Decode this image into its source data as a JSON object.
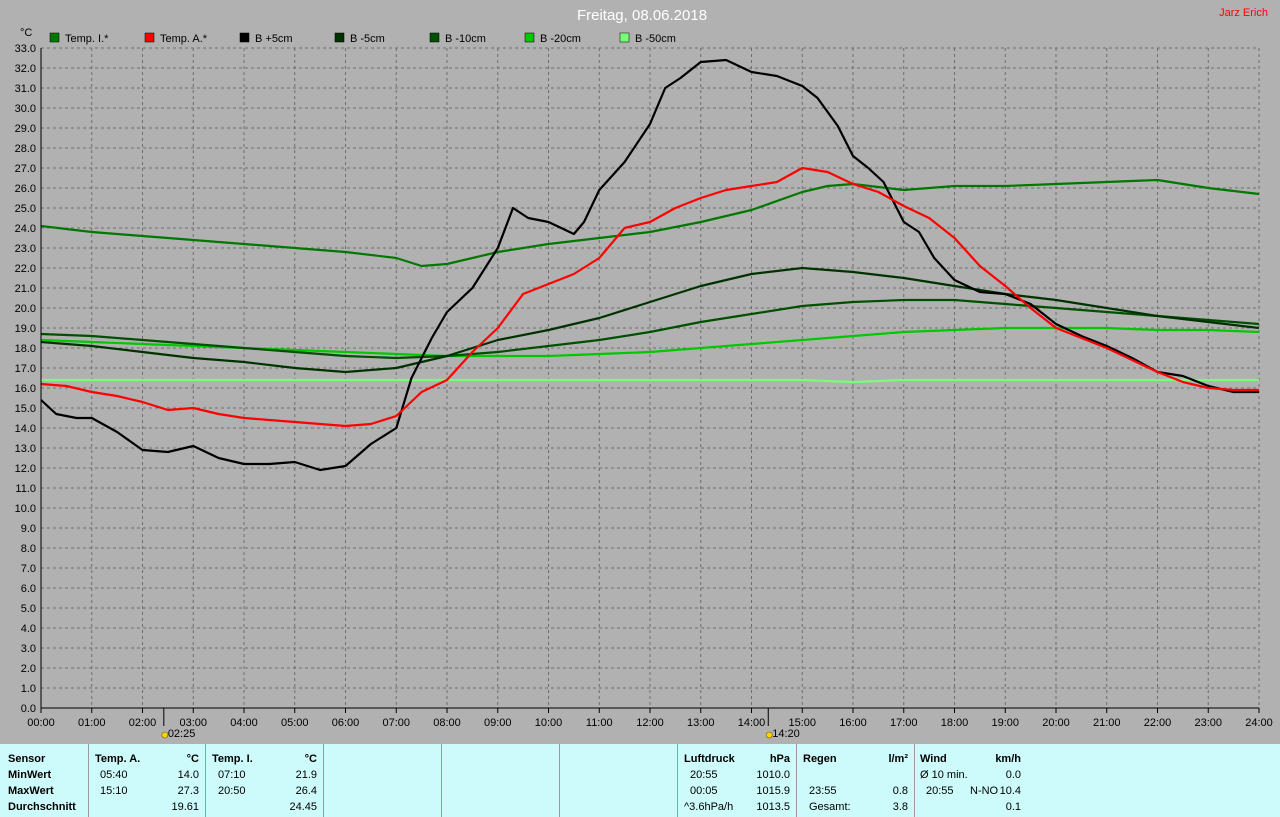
{
  "header": {
    "title": "Freitag, 08.06.2018",
    "author": "Jarz Erich",
    "y_unit": "°C"
  },
  "colors": {
    "background": "#b1b1b1",
    "plot_background": "#b1b1b1",
    "info_background": "#cdfafa",
    "title_color": "#ffffff",
    "author_color": "#ff0000"
  },
  "chart_data": {
    "type": "line",
    "title": "Freitag, 08.06.2018",
    "ylabel": "°C",
    "xlabel": "",
    "ylim": [
      0,
      33
    ],
    "xlim": [
      0,
      24
    ],
    "yticks": [
      "0.0",
      "1.0",
      "2.0",
      "3.0",
      "4.0",
      "5.0",
      "6.0",
      "7.0",
      "8.0",
      "9.0",
      "10.0",
      "11.0",
      "12.0",
      "13.0",
      "14.0",
      "15.0",
      "16.0",
      "17.0",
      "18.0",
      "19.0",
      "20.0",
      "21.0",
      "22.0",
      "23.0",
      "24.0",
      "25.0",
      "26.0",
      "27.0",
      "28.0",
      "29.0",
      "30.0",
      "31.0",
      "32.0",
      "33.0"
    ],
    "xticks": [
      "00:00",
      "01:00",
      "02:00",
      "03:00",
      "04:00",
      "05:00",
      "06:00",
      "07:00",
      "08:00",
      "09:00",
      "10:00",
      "11:00",
      "12:00",
      "13:00",
      "14:00",
      "15:00",
      "16:00",
      "17:00",
      "18:00",
      "19:00",
      "20:00",
      "21:00",
      "22:00",
      "23:00",
      "24:00"
    ],
    "grid": true,
    "legend_position": "top",
    "markers": [
      {
        "label": "02:25",
        "x": 2.42,
        "icon": "sunrise-icon"
      },
      {
        "label": "14:20",
        "x": 14.33,
        "icon": "sun-icon"
      }
    ],
    "series": [
      {
        "name": "Temp. I.*",
        "color": "#007800",
        "x": [
          0,
          1,
          2,
          3,
          4,
          5,
          6,
          7,
          7.5,
          8,
          9,
          10,
          11,
          12,
          13,
          14,
          15,
          15.5,
          16,
          17,
          18,
          19,
          20,
          21,
          22,
          23,
          24
        ],
        "y": [
          24.1,
          23.8,
          23.6,
          23.4,
          23.2,
          23.0,
          22.8,
          22.5,
          22.1,
          22.2,
          22.8,
          23.2,
          23.5,
          23.8,
          24.3,
          24.9,
          25.8,
          26.1,
          26.2,
          25.9,
          26.1,
          26.1,
          26.2,
          26.3,
          26.4,
          26.0,
          25.7
        ]
      },
      {
        "name": "Temp. A.*",
        "color": "#ff0000",
        "x": [
          0,
          0.5,
          1,
          1.5,
          2,
          2.5,
          3,
          3.5,
          4,
          4.5,
          5,
          5.5,
          6,
          6.5,
          7,
          7.5,
          8,
          8.5,
          9,
          9.5,
          10,
          10.5,
          11,
          11.5,
          12,
          12.5,
          13,
          13.5,
          14,
          14.5,
          15,
          15.5,
          16,
          16.5,
          17,
          17.5,
          18,
          18.5,
          19,
          19.5,
          20,
          20.5,
          21,
          21.5,
          22,
          22.5,
          23,
          23.5,
          24
        ],
        "y": [
          16.2,
          16.1,
          15.8,
          15.6,
          15.3,
          14.9,
          15.0,
          14.7,
          14.5,
          14.4,
          14.3,
          14.2,
          14.1,
          14.2,
          14.6,
          15.8,
          16.4,
          17.8,
          19.0,
          20.7,
          21.2,
          21.7,
          22.5,
          24.0,
          24.3,
          25.0,
          25.5,
          25.9,
          26.1,
          26.3,
          27.0,
          26.8,
          26.2,
          25.8,
          25.1,
          24.5,
          23.5,
          22.1,
          21.1,
          20.0,
          19.0,
          18.5,
          18.0,
          17.4,
          16.8,
          16.3,
          16.0,
          15.9,
          15.9
        ]
      },
      {
        "name": "B +5cm",
        "color": "#000000",
        "x": [
          0,
          0.3,
          0.7,
          1,
          1.5,
          2,
          2.5,
          3,
          3.5,
          4,
          4.5,
          5,
          5.5,
          6,
          6.5,
          7,
          7.3,
          7.7,
          8,
          8.5,
          9,
          9.3,
          9.6,
          10,
          10.5,
          10.7,
          11,
          11.5,
          12,
          12.3,
          12.6,
          13,
          13.5,
          14,
          14.5,
          15,
          15.3,
          15.7,
          16,
          16.3,
          16.6,
          17,
          17.3,
          17.6,
          18,
          18.5,
          19,
          19.5,
          20,
          20.5,
          21,
          21.5,
          22,
          22.5,
          23,
          23.5,
          24
        ],
        "y": [
          15.4,
          14.7,
          14.5,
          14.5,
          13.8,
          12.9,
          12.8,
          13.1,
          12.5,
          12.2,
          12.2,
          12.3,
          11.9,
          12.1,
          13.2,
          14.0,
          16.5,
          18.5,
          19.8,
          21.0,
          23.0,
          25.0,
          24.5,
          24.3,
          23.7,
          24.3,
          25.9,
          27.3,
          29.2,
          31.0,
          31.5,
          32.3,
          32.4,
          31.8,
          31.6,
          31.1,
          30.5,
          29.1,
          27.6,
          27.0,
          26.3,
          24.3,
          23.8,
          22.5,
          21.4,
          20.8,
          20.7,
          20.2,
          19.2,
          18.6,
          18.1,
          17.5,
          16.8,
          16.6,
          16.1,
          15.8,
          15.8
        ]
      },
      {
        "name": "B -5cm",
        "color": "#003200",
        "x": [
          0,
          1,
          2,
          3,
          4,
          5,
          6,
          7,
          8,
          9,
          10,
          11,
          12,
          13,
          14,
          15,
          16,
          17,
          18,
          19,
          20,
          21,
          22,
          23,
          24
        ],
        "y": [
          18.3,
          18.1,
          17.8,
          17.5,
          17.3,
          17.0,
          16.8,
          17.0,
          17.6,
          18.4,
          18.9,
          19.5,
          20.3,
          21.1,
          21.7,
          22.0,
          21.8,
          21.5,
          21.1,
          20.7,
          20.4,
          20.0,
          19.6,
          19.3,
          19.0
        ]
      },
      {
        "name": "B -10cm",
        "color": "#005000",
        "x": [
          0,
          1,
          2,
          3,
          4,
          5,
          6,
          7,
          8,
          9,
          10,
          11,
          12,
          13,
          14,
          15,
          16,
          17,
          18,
          19,
          20,
          21,
          22,
          23,
          24
        ],
        "y": [
          18.7,
          18.6,
          18.4,
          18.2,
          18.0,
          17.8,
          17.6,
          17.5,
          17.6,
          17.8,
          18.1,
          18.4,
          18.8,
          19.3,
          19.7,
          20.1,
          20.3,
          20.4,
          20.4,
          20.2,
          20.0,
          19.8,
          19.6,
          19.4,
          19.2
        ]
      },
      {
        "name": "B -20cm",
        "color": "#00c800",
        "x": [
          0,
          1,
          2,
          3,
          4,
          5,
          6,
          7,
          8,
          9,
          10,
          11,
          12,
          13,
          14,
          15,
          16,
          17,
          18,
          19,
          20,
          21,
          22,
          23,
          24
        ],
        "y": [
          18.4,
          18.3,
          18.2,
          18.1,
          18.0,
          17.9,
          17.8,
          17.7,
          17.6,
          17.6,
          17.6,
          17.7,
          17.8,
          18.0,
          18.2,
          18.4,
          18.6,
          18.8,
          18.9,
          19.0,
          19.0,
          19.0,
          18.9,
          18.9,
          18.8
        ]
      },
      {
        "name": "B -50cm",
        "color": "#78ff78",
        "x": [
          0,
          2,
          4,
          6,
          8,
          10,
          12,
          14,
          15,
          16,
          17,
          18,
          20,
          22,
          24
        ],
        "y": [
          16.4,
          16.4,
          16.4,
          16.4,
          16.4,
          16.4,
          16.4,
          16.4,
          16.4,
          16.3,
          16.4,
          16.4,
          16.4,
          16.4,
          16.4
        ]
      }
    ]
  },
  "info": {
    "sensor": {
      "label": "Sensor",
      "min": "MinWert",
      "max": "MaxWert",
      "avg": "Durchschnitt"
    },
    "temp_a": {
      "label": "Temp. A.",
      "unit": "°C",
      "min_time": "05:40",
      "min_val": "14.0",
      "max_time": "15:10",
      "max_val": "27.3",
      "avg": "19.61"
    },
    "temp_i": {
      "label": "Temp. I.",
      "unit": "°C",
      "min_time": "07:10",
      "min_val": "21.9",
      "max_time": "20:50",
      "max_val": "26.4",
      "avg": "24.45"
    },
    "pressure": {
      "label": "Luftdruck",
      "unit": "hPa",
      "min_time": "20:55",
      "min_val": "1010.0",
      "max_time": "00:05",
      "max_val": "1015.9",
      "avg_label": "^3.6hPa/h",
      "avg_val": "1013.5"
    },
    "rain": {
      "label": "Regen",
      "unit": "l/m²",
      "max_time": "23:55",
      "max_val": "0.8",
      "total_label": "Gesamt:",
      "total_val": "3.8"
    },
    "wind": {
      "label": "Wind",
      "unit": "km/h",
      "min_label": "Ø 10 min.",
      "min_val": "0.0",
      "max_time": "20:55",
      "max_dir": "N-NO",
      "max_val": "10.4",
      "avg_val": "0.1"
    }
  }
}
